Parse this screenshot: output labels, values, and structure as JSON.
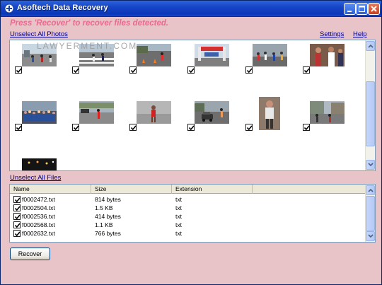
{
  "window": {
    "title": "Asoftech Data Recovery",
    "icon": "plus-shield-icon"
  },
  "prompt": "Press 'Recover' to recover files detected.",
  "links": {
    "unselect_photos": "Unselect All Photos",
    "settings": "Settings",
    "help": "Help",
    "unselect_files": "Unselect All Files"
  },
  "watermark": "LAWYERMENT.COM",
  "photos": [
    {
      "checked": true,
      "subject": "marathon runners road"
    },
    {
      "checked": true,
      "subject": "runners crossing street"
    },
    {
      "checked": true,
      "subject": "runners with cones"
    },
    {
      "checked": true,
      "subject": "finish line gate"
    },
    {
      "checked": true,
      "subject": "crowd of runners"
    },
    {
      "checked": true,
      "subject": "runners close-up"
    },
    {
      "checked": true,
      "subject": "spectators and runners"
    },
    {
      "checked": true,
      "subject": "single runner"
    },
    {
      "checked": true,
      "subject": "runner on track"
    },
    {
      "checked": true,
      "subject": "car and runners"
    },
    {
      "checked": true,
      "subject": "runner portrait"
    },
    {
      "checked": true,
      "subject": "runners with buildings"
    },
    {
      "checked": true,
      "subject": "night scene"
    }
  ],
  "file_table": {
    "columns": [
      "Name",
      "Size",
      "Extension"
    ],
    "rows": [
      {
        "name": "f0002472.txt",
        "size": "814 bytes",
        "ext": "txt",
        "checked": true
      },
      {
        "name": "f0002504.txt",
        "size": "1.5 KB",
        "ext": "txt",
        "checked": true
      },
      {
        "name": "f0002536.txt",
        "size": "414 bytes",
        "ext": "txt",
        "checked": true
      },
      {
        "name": "f0002568.txt",
        "size": "1.1 KB",
        "ext": "txt",
        "checked": true
      },
      {
        "name": "f0002632.txt",
        "size": "766 bytes",
        "ext": "txt",
        "checked": true
      }
    ]
  },
  "buttons": {
    "recover": "Recover"
  },
  "colors": {
    "background": "#e8c3c7",
    "prompt": "#e86a8e",
    "link": "#00008b",
    "titlebar": "#1745c7"
  }
}
